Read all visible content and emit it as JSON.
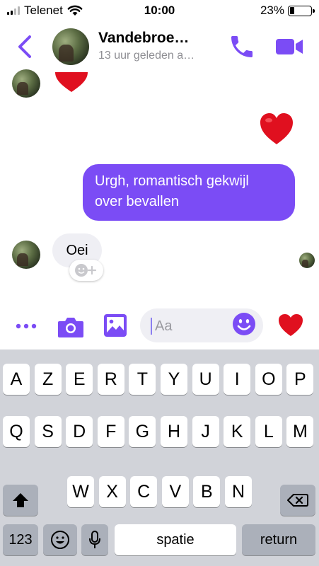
{
  "status_bar": {
    "carrier": "Telenet",
    "time": "10:00",
    "battery": "23%",
    "battery_level": 0.23
  },
  "header": {
    "name": "Vandebroe…",
    "subtitle": "13 uur geleden a…"
  },
  "messages": {
    "outgoing_text_line1": "Urgh, romantisch gekwijl",
    "outgoing_text_line2": "over bevallen",
    "incoming_text": "Oei"
  },
  "composer": {
    "placeholder": "Aa"
  },
  "keyboard": {
    "row1": [
      "A",
      "Z",
      "E",
      "R",
      "T",
      "Y",
      "U",
      "I",
      "O",
      "P"
    ],
    "row2": [
      "Q",
      "S",
      "D",
      "F",
      "G",
      "H",
      "J",
      "K",
      "L",
      "M"
    ],
    "row3": [
      "W",
      "X",
      "C",
      "V",
      "B",
      "N"
    ],
    "numbers_label": "123",
    "space_label": "spatie",
    "return_label": "return"
  },
  "colors": {
    "accent": "#7b4cf5",
    "heart": "#e0101f"
  }
}
